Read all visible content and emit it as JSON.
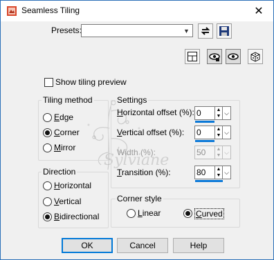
{
  "window": {
    "title": "Seamless Tiling"
  },
  "presets": {
    "label": "Presets:",
    "value": ""
  },
  "show_tiling_preview": {
    "label": "Show tiling preview",
    "checked": false
  },
  "tiling_method": {
    "title": "Tiling method",
    "options": [
      {
        "label": "Edge",
        "checked": false
      },
      {
        "label": "Corner",
        "checked": true
      },
      {
        "label": "Mirror",
        "checked": false
      }
    ]
  },
  "direction": {
    "title": "Direction",
    "options": [
      {
        "label": "Horizontal",
        "checked": false
      },
      {
        "label": "Vertical",
        "checked": false
      },
      {
        "label": "Bidirectional",
        "checked": true
      }
    ]
  },
  "settings": {
    "title": "Settings",
    "horizontal_offset": {
      "label": "Horizontal offset (%):",
      "value": "0"
    },
    "vertical_offset": {
      "label": "Vertical offset (%):",
      "value": "0"
    },
    "width": {
      "label": "Width (%):",
      "value": "50",
      "disabled": true
    },
    "transition": {
      "label": "Transition (%):",
      "value": "80"
    }
  },
  "corner_style": {
    "title": "Corner style",
    "options": [
      {
        "label": "Linear",
        "checked": false
      },
      {
        "label": "Curved",
        "checked": true
      }
    ]
  },
  "buttons": {
    "ok": "OK",
    "cancel": "Cancel",
    "help": "Help"
  },
  "watermark_text": "Sylviane",
  "icons": {
    "title": "app-icon",
    "close": "close-icon",
    "preset_dropdown": "chevron-down-icon",
    "reset": "reset-icon",
    "save": "save-icon",
    "layout": "layout-icon",
    "eye1": "eye-icon",
    "eye2": "eye-icon",
    "random": "dice-icon"
  },
  "colors": {
    "accent": "#0078d7",
    "border": "#2a6fb8",
    "window_bg": "#f0f0f0"
  }
}
